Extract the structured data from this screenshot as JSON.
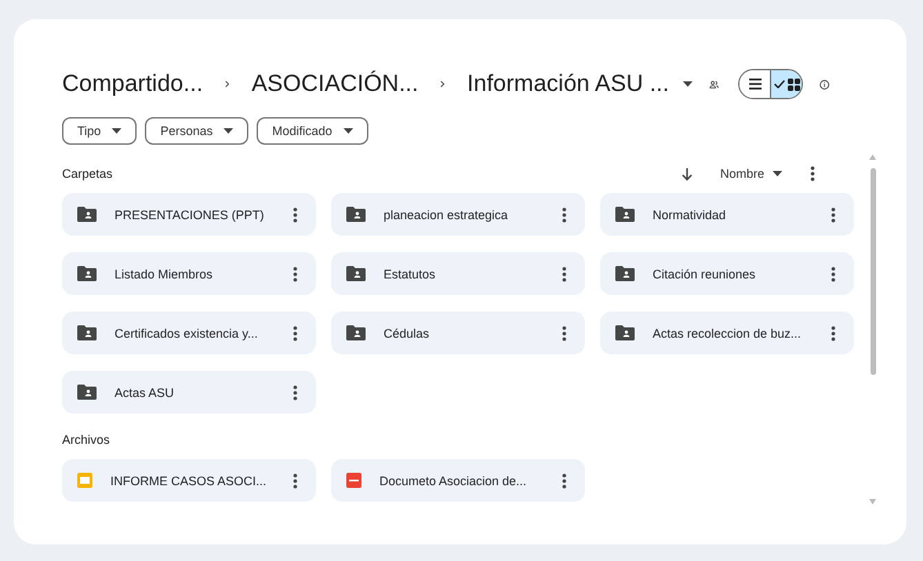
{
  "breadcrumb": [
    {
      "label": "Compartido..."
    },
    {
      "label": "ASOCIACIÓN..."
    },
    {
      "label": "Información ASU ..."
    }
  ],
  "view_toggle": [
    {
      "kind": "list",
      "selected": false
    },
    {
      "kind": "grid",
      "selected": true
    }
  ],
  "filters": [
    {
      "label": "Tipo"
    },
    {
      "label": "Personas"
    },
    {
      "label": "Modificado"
    }
  ],
  "folders_section": {
    "title": "Carpetas",
    "sort": "Nombre"
  },
  "folders": [
    {
      "name": "PRESENTACIONES (PPT)"
    },
    {
      "name": "planeacion estrategica"
    },
    {
      "name": "Normatividad"
    },
    {
      "name": "Listado Miembros"
    },
    {
      "name": "Estatutos"
    },
    {
      "name": "Citación reuniones"
    },
    {
      "name": "Certificados existencia y..."
    },
    {
      "name": "Cédulas"
    },
    {
      "name": "Actas recoleccion de buz..."
    },
    {
      "name": "Actas ASU"
    }
  ],
  "files_section": {
    "title": "Archivos"
  },
  "files": [
    {
      "name": "INFORME CASOS ASOCI...",
      "kind": "slides"
    },
    {
      "name": "Documeto Asociacion de...",
      "kind": "pdf"
    }
  ]
}
